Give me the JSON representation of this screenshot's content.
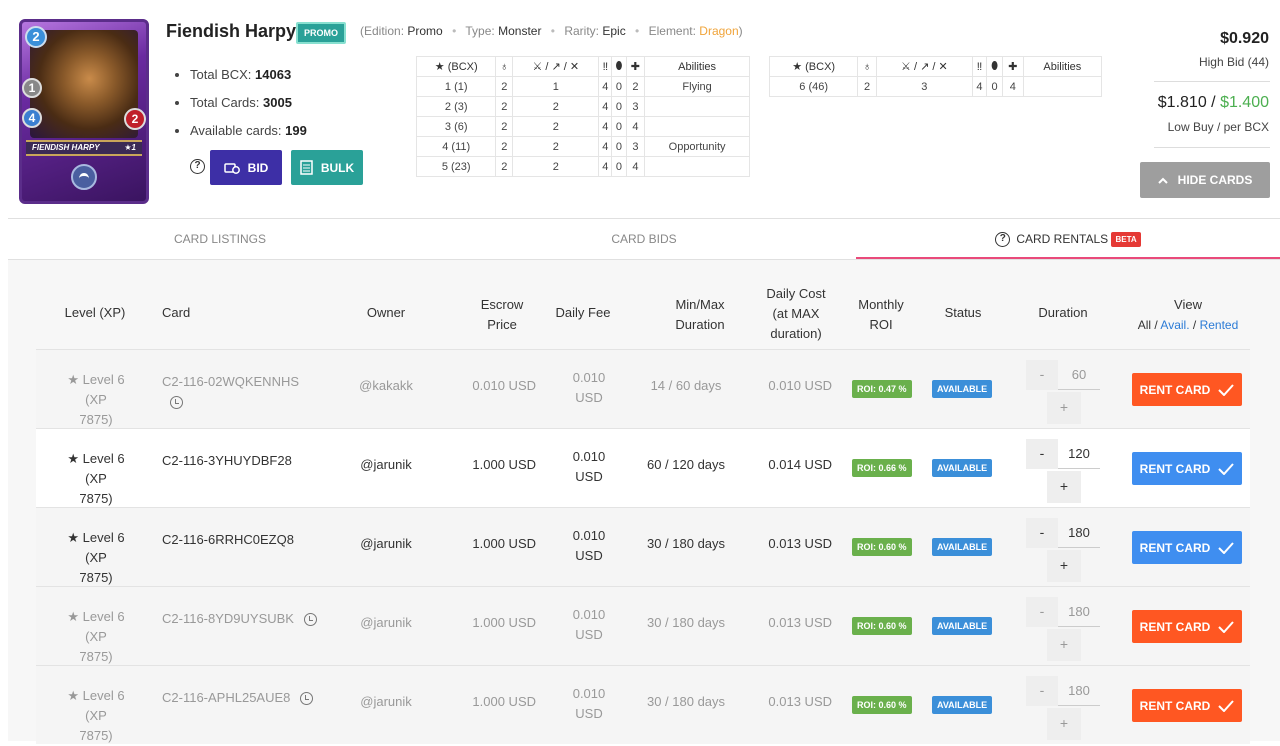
{
  "card": {
    "name": "Fiendish Harpy",
    "badge": "PROMO",
    "plate_name": "FIENDISH HARPY",
    "plate_level": "★1",
    "mana": "2",
    "stat_melee": "1",
    "stat_speed": "4",
    "stat_health": "2",
    "edition_label": "(Edition:",
    "edition": "Promo",
    "type_label": "Type:",
    "type": "Monster",
    "rarity_label": "Rarity:",
    "rarity": "Epic",
    "element_label": "Element:",
    "element": "Dragon",
    "element_close": ")",
    "element_color": "#f0a43a"
  },
  "stats": {
    "total_bcx_label": "Total BCX:",
    "total_bcx": "14063",
    "total_cards_label": "Total Cards:",
    "total_cards": "3005",
    "available_label": "Available cards:",
    "available": "199"
  },
  "actions": {
    "help": "?",
    "bid": "BID",
    "bulk": "BULK",
    "hide_cards": "HIDE CARDS"
  },
  "level_table": {
    "headers": [
      "★ (BCX)",
      "♁",
      "⚔ / ↗ / ✕",
      "‼",
      "⬮",
      "✚",
      "Abilities"
    ],
    "rows": [
      [
        "1 (1)",
        "2",
        "1",
        "4",
        "0",
        "2",
        "Flying"
      ],
      [
        "2 (3)",
        "2",
        "2",
        "4",
        "0",
        "3",
        ""
      ],
      [
        "3 (6)",
        "2",
        "2",
        "4",
        "0",
        "4",
        ""
      ],
      [
        "4 (11)",
        "2",
        "2",
        "4",
        "0",
        "3",
        "Opportunity"
      ],
      [
        "5 (23)",
        "2",
        "2",
        "4",
        "0",
        "4",
        ""
      ]
    ]
  },
  "level_table_2": {
    "headers": [
      "★ (BCX)",
      "♁",
      "⚔ / ↗ / ✕",
      "‼",
      "⬮",
      "✚",
      "Abilities"
    ],
    "rows": [
      [
        "6 (46)",
        "2",
        "3",
        "4",
        "0",
        "4",
        ""
      ]
    ]
  },
  "pricing": {
    "high_bid": "$0.920",
    "high_bid_label": "High Bid (44)",
    "low_buy": "$1.810",
    "sep": " / ",
    "per_bcx": "$1.400",
    "low_buy_label": "Low Buy / per BCX",
    "green": "#4caf50"
  },
  "tabs": {
    "listings": "CARD LISTINGS",
    "bids": "CARD BIDS",
    "rentals": "CARD RENTALS",
    "beta": "BETA"
  },
  "columns": {
    "level": "Level (XP)",
    "card": "Card",
    "owner": "Owner",
    "escrow_1": "Escrow",
    "escrow_2": "Price",
    "fee": "Daily Fee",
    "minmax_1": "Min/Max",
    "minmax_2": "Duration",
    "cost_1": "Daily Cost",
    "cost_2": "(at MAX",
    "cost_3": "duration)",
    "roi_1": "Monthly",
    "roi_2": "ROI",
    "status": "Status",
    "duration": "Duration",
    "view": "View",
    "view_all": "All",
    "view_sep": " / ",
    "view_avail": "Avail.",
    "view_rented": "Rented"
  },
  "rentals": [
    {
      "level": "Level 6",
      "xp1": " (XP",
      "xp2": "7875)",
      "card": "C2-116-02WQKENNHS",
      "owner": "@kakakk",
      "escrow": "0.010 USD",
      "fee1": "0.010",
      "fee2": "USD",
      "duration": "14 / 60 days",
      "cost": "0.010 USD",
      "roi": "ROI: 0.47 %",
      "status": "AVAILABLE",
      "days": "60",
      "action": "RENT CARD",
      "minus": "-",
      "plus": "+"
    },
    {
      "level": "Level 6",
      "xp1": " (XP",
      "xp2": "7875)",
      "card": "C2-116-3YHUYDBF28",
      "owner": "@jarunik",
      "escrow": "1.000 USD",
      "fee1": "0.010",
      "fee2": "USD",
      "duration": "60 / 120 days",
      "cost": "0.014 USD",
      "roi": "ROI: 0.66 %",
      "status": "AVAILABLE",
      "days": "120",
      "action": "RENT CARD",
      "minus": "-",
      "plus": "+"
    },
    {
      "level": "Level 6",
      "xp1": " (XP",
      "xp2": "7875)",
      "card": "C2-116-6RRHC0EZQ8",
      "owner": "@jarunik",
      "escrow": "1.000 USD",
      "fee1": "0.010",
      "fee2": "USD",
      "duration": "30 / 180 days",
      "cost": "0.013 USD",
      "roi": "ROI: 0.60 %",
      "status": "AVAILABLE",
      "days": "180",
      "action": "RENT CARD",
      "minus": "-",
      "plus": "+"
    },
    {
      "level": "Level 6",
      "xp1": " (XP",
      "xp2": "7875)",
      "card": "C2-116-8YD9UYSUBK",
      "owner": "@jarunik",
      "escrow": "1.000 USD",
      "fee1": "0.010",
      "fee2": "USD",
      "duration": "30 / 180 days",
      "cost": "0.013 USD",
      "roi": "ROI: 0.60 %",
      "status": "AVAILABLE",
      "days": "180",
      "action": "RENT CARD",
      "minus": "-",
      "plus": "+"
    },
    {
      "level": "Level 6",
      "xp1": " (XP",
      "xp2": "7875)",
      "card": "C2-116-APHL25AUE8",
      "owner": "@jarunik",
      "escrow": "1.000 USD",
      "fee1": "0.010",
      "fee2": "USD",
      "duration": "30 / 180 days",
      "cost": "0.013 USD",
      "roi": "ROI: 0.60 %",
      "status": "AVAILABLE",
      "days": "180",
      "action": "RENT CARD",
      "minus": "-",
      "plus": "+"
    }
  ]
}
